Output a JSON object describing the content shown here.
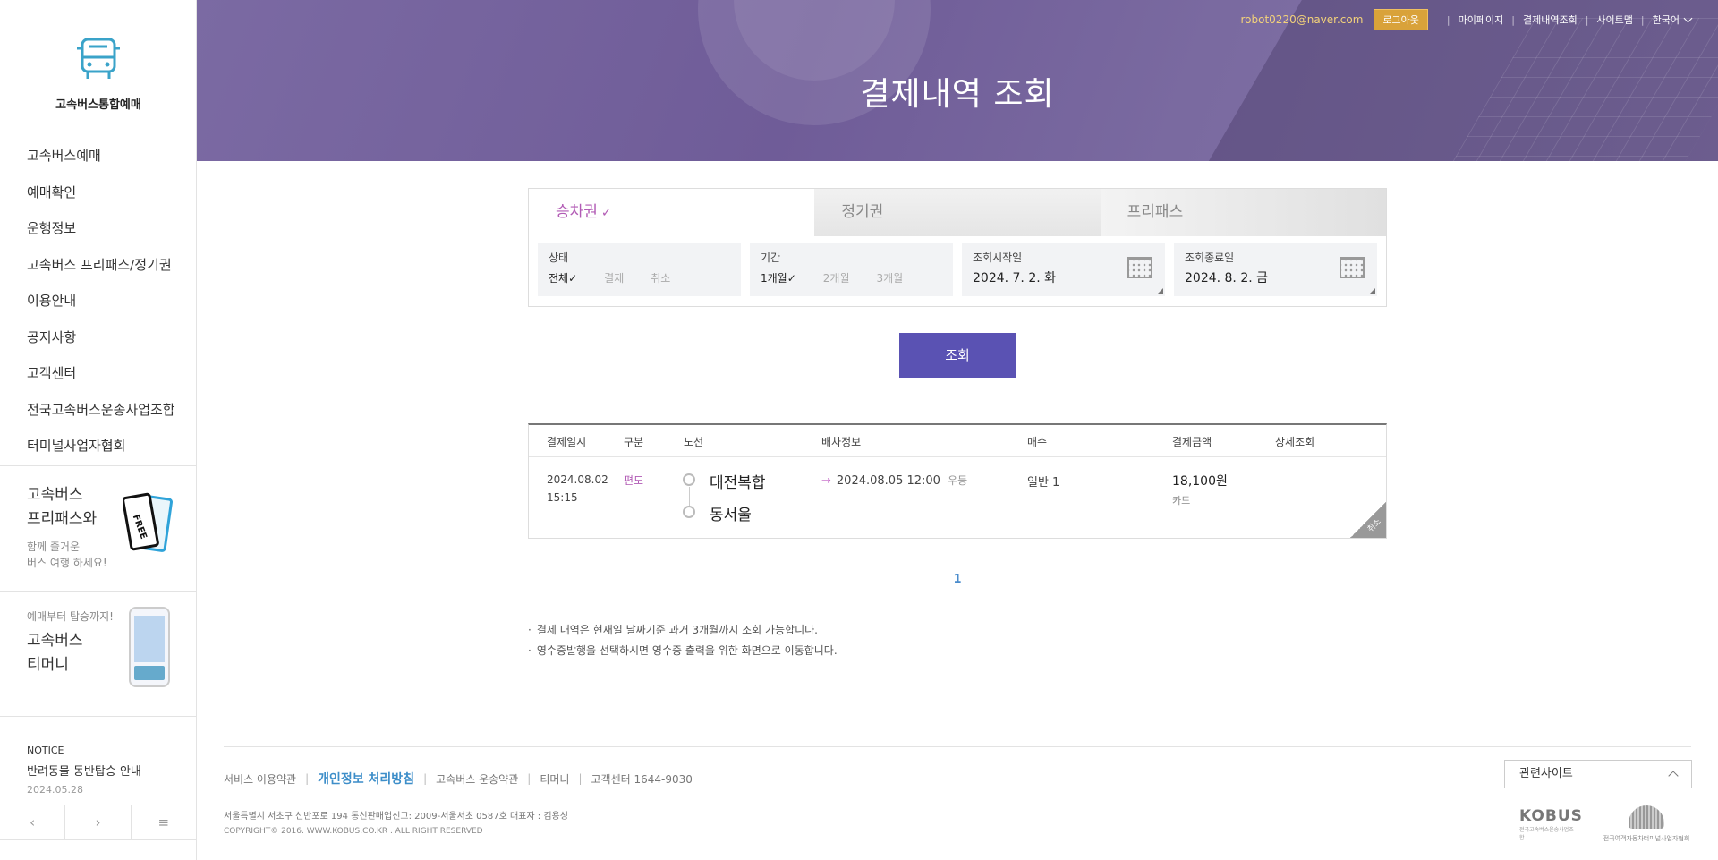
{
  "sidebar": {
    "logo_text": "고속버스통합예매",
    "nav": [
      "고속버스예매",
      "예매확인",
      "운행정보",
      "고속버스 프리패스/정기권",
      "이용안내",
      "공지사항",
      "고객센터",
      "전국고속버스운송사업조합",
      "터미널사업자협회"
    ],
    "promo_freepass": {
      "line1": "고속버스",
      "line2": "프리패스와",
      "sub1": "함께 즐거운",
      "sub2": "버스 여행 하세요!",
      "art_text": "FREE"
    },
    "promo_tmoney": {
      "small": "예매부터 탑승까지!",
      "line1": "고속버스",
      "line2": "티머니"
    },
    "notice": {
      "label": "NOTICE",
      "title": "반려동물 동반탑승 안내",
      "date": "2024.05.28"
    },
    "controls": {
      "prev": "‹",
      "next": "›",
      "menu": "≡"
    }
  },
  "header": {
    "title": "결제내역 조회",
    "util": {
      "email": "robot0220@naver.com",
      "logout": "로그아웃",
      "mypage": "마이페이지",
      "payment_history": "결제내역조회",
      "sitemap": "사이트맵",
      "language": "한국어"
    }
  },
  "tabs": [
    {
      "label": "승차권",
      "check": "✓"
    },
    {
      "label": "정기권"
    },
    {
      "label": "프리패스"
    }
  ],
  "filters": {
    "status": {
      "label": "상태",
      "options": [
        {
          "text": "전체",
          "selected": true,
          "mark": "✓"
        },
        {
          "text": "결제"
        },
        {
          "text": "취소"
        }
      ]
    },
    "period": {
      "label": "기간",
      "options": [
        {
          "text": "1개월",
          "selected": true,
          "mark": "✓"
        },
        {
          "text": "2개월"
        },
        {
          "text": "3개월"
        }
      ]
    },
    "start": {
      "label": "조회시작일",
      "value": "2024. 7. 2. 화"
    },
    "end": {
      "label": "조회종료일",
      "value": "2024. 8. 2. 금"
    }
  },
  "search_button": "조회",
  "result": {
    "headers": [
      "결제일시",
      "구분",
      "노선",
      "배차정보",
      "매수",
      "결제금액",
      "상세조회"
    ],
    "rows": [
      {
        "date": "2024.08.02",
        "time": "15:15",
        "type": "편도",
        "origin": "대전복합",
        "destination": "동서울",
        "arrow": "→",
        "dispatch": "2024.08.05 12:00",
        "grade": "우등",
        "count": "일반 1",
        "amount": "18,100원",
        "method": "카드",
        "cancel": "취소"
      }
    ]
  },
  "pagination": {
    "current": "1"
  },
  "notes": [
    "결제 내역은 현재일 날짜기준 과거 3개월까지 조회 가능합니다.",
    "영수증발행을 선택하시면 영수증 출력을 위한 화면으로 이동합니다."
  ],
  "footer": {
    "links": [
      "서비스 이용약관",
      "개인정보 처리방침",
      "고속버스 운송약관",
      "티머니",
      "고객센터 1644-9030"
    ],
    "address": "서울특별시 서초구 신반포로 194 통신판매업신고: 2009-서울서초 0587호 대표자 : 김용성",
    "copyright": "COPYRIGHT© 2016. WWW.KOBUS.CO.KR . ALL RIGHT RESERVED",
    "related_sites": "관련사이트",
    "kobus_logo": "KOBUS",
    "kobus_sub": "전국고속버스운송사업조합",
    "assoc_text": "전국여객자동차터미널사업자협회"
  },
  "colors": {
    "accent_purple": "#5a52b3",
    "tab_active": "#b25bb5",
    "logout_gold": "#d9a23a",
    "banner": "#6f5c98"
  }
}
